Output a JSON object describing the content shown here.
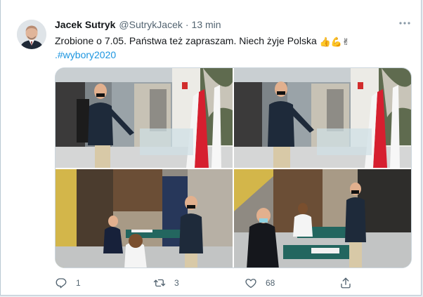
{
  "tweet": {
    "author_name": "Jacek Sutryk",
    "handle": "@SutrykJacek",
    "separator": "·",
    "time": "13 min",
    "text_main": "Zrobione o 7.05. Państwa też zapraszam. Niech żyje Polska",
    "emojis": [
      "👍",
      "💪",
      "✌"
    ],
    "text_prefix": ".",
    "hashtag": "#wybory2020"
  },
  "media": {
    "photos": [
      {
        "name": "photo-top-left",
        "scene": "voting-booth-flags"
      },
      {
        "name": "photo-top-right",
        "scene": "voting-booth-flags"
      },
      {
        "name": "photo-bottom-left",
        "scene": "polling-station-room"
      },
      {
        "name": "photo-bottom-right",
        "scene": "polling-station-registration"
      }
    ]
  },
  "actions": {
    "reply": {
      "icon": "reply-icon",
      "count": "1"
    },
    "retweet": {
      "icon": "retweet-icon",
      "count": "3"
    },
    "like": {
      "icon": "heart-icon",
      "count": "68"
    },
    "share": {
      "icon": "share-icon",
      "count": ""
    }
  },
  "colors": {
    "link": "#1b95e0",
    "muted": "#536471",
    "text": "#14171a",
    "flag_red": "#d61f2f"
  }
}
